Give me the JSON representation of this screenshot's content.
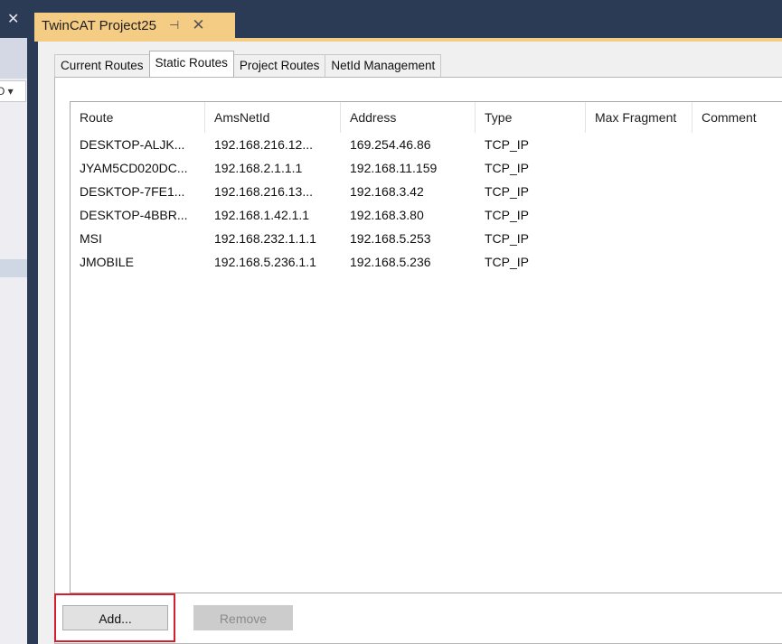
{
  "left_panel": {
    "close_glyph": "✕",
    "combo_text": "O ▾"
  },
  "document_tab": {
    "title": "TwinCAT Project25",
    "pin_glyph": "⊣",
    "close_glyph": "✕"
  },
  "subtabs": [
    {
      "label": "Current Routes",
      "active": false
    },
    {
      "label": "Static Routes",
      "active": true
    },
    {
      "label": "Project Routes",
      "active": false
    },
    {
      "label": "NetId Management",
      "active": false
    }
  ],
  "routes_table": {
    "columns": [
      "Route",
      "AmsNetId",
      "Address",
      "Type",
      "Max Fragment",
      "Comment"
    ],
    "rows": [
      [
        "DESKTOP-ALJK...",
        "192.168.216.12...",
        "169.254.46.86",
        "TCP_IP",
        "",
        ""
      ],
      [
        "JYAM5CD020DC...",
        "192.168.2.1.1.1",
        "192.168.11.159",
        "TCP_IP",
        "",
        ""
      ],
      [
        "DESKTOP-7FE1...",
        "192.168.216.13...",
        "192.168.3.42",
        "TCP_IP",
        "",
        ""
      ],
      [
        "DESKTOP-4BBR...",
        "192.168.1.42.1.1",
        "192.168.3.80",
        "TCP_IP",
        "",
        ""
      ],
      [
        "MSI",
        "192.168.232.1.1.1",
        "192.168.5.253",
        "TCP_IP",
        "",
        ""
      ],
      [
        "JMOBILE",
        "192.168.5.236.1.1",
        "192.168.5.236",
        "TCP_IP",
        "",
        ""
      ]
    ]
  },
  "buttons": {
    "add_label": "Add...",
    "remove_label": "Remove"
  },
  "colors": {
    "tab_accent": "#f5cc84",
    "highlight": "#d0202f",
    "frame_dark": "#2b3a55"
  }
}
